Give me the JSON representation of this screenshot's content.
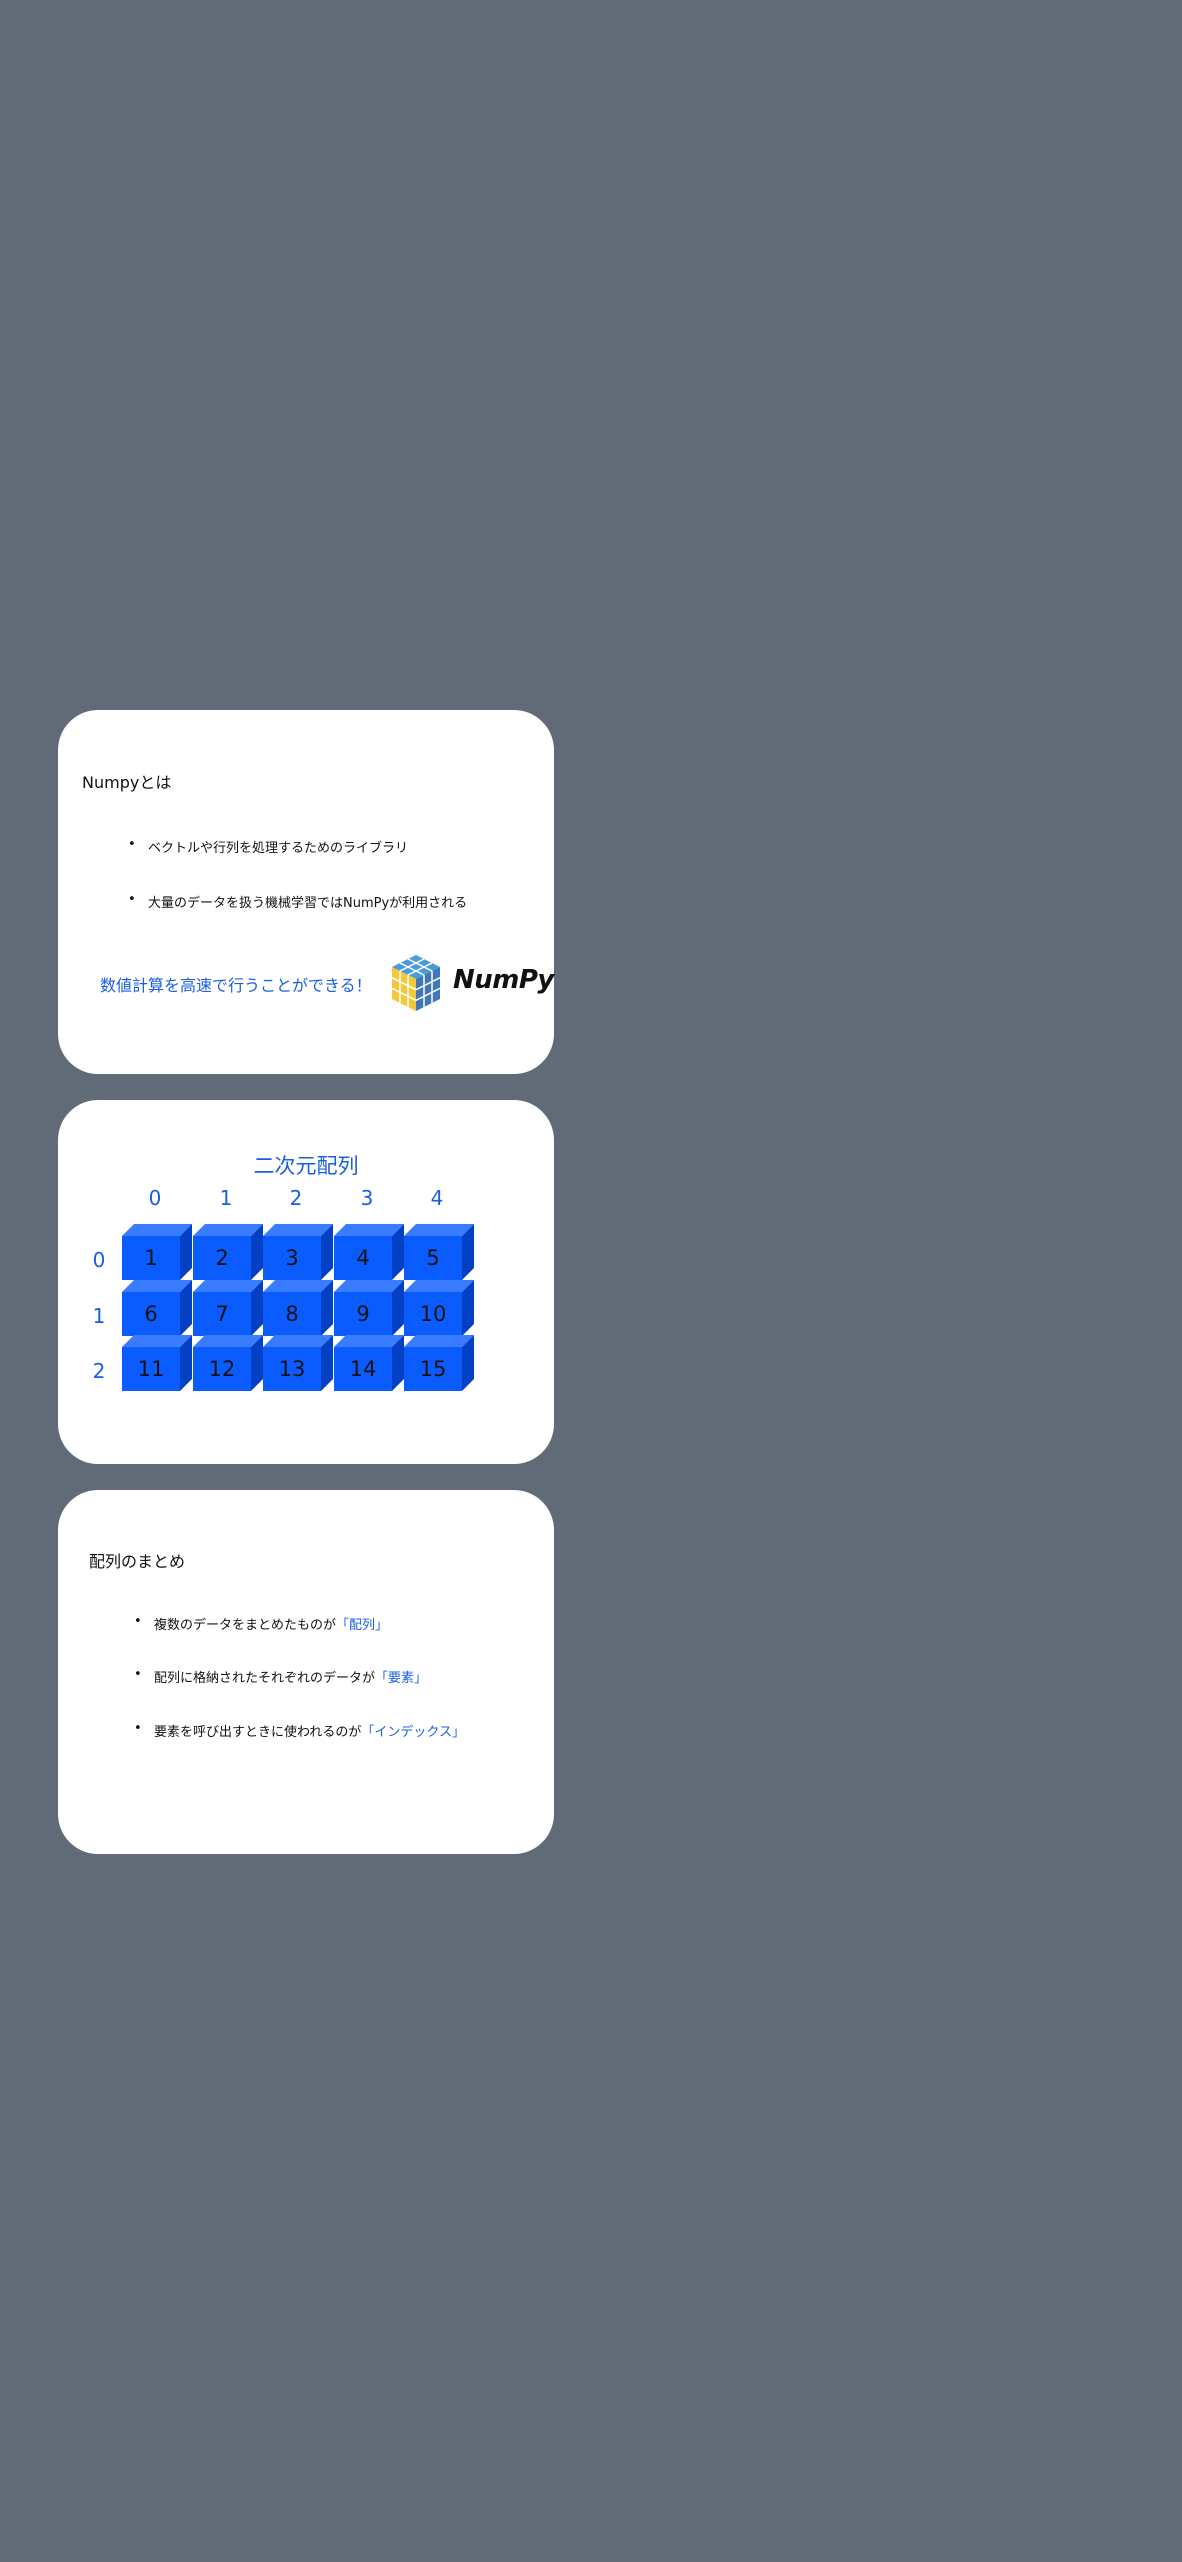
{
  "card1": {
    "title": "Numpyとは",
    "bullets": [
      "ベクトルや行列を処理するためのライブラリ",
      "大量のデータを扱う機械学習ではNumPyが利用される"
    ],
    "tagline": "数値計算を高速で行うことができる！",
    "logo_text": "NumPy",
    "logo_icon": "numpy-cube-logo"
  },
  "card2": {
    "title": "二次元配列",
    "col_indices": [
      "0",
      "1",
      "2",
      "3",
      "4"
    ],
    "row_indices": [
      "0",
      "1",
      "2"
    ],
    "cells": [
      [
        "1",
        "2",
        "3",
        "4",
        "5"
      ],
      [
        "6",
        "7",
        "8",
        "9",
        "10"
      ],
      [
        "11",
        "12",
        "13",
        "14",
        "15"
      ]
    ]
  },
  "card3": {
    "title": "配列のまとめ",
    "bullets": [
      {
        "text": "複数のデータをまとめたものが",
        "highlight": "「配列」"
      },
      {
        "text": "配列に格納されたそれぞれのデータが",
        "highlight": "「要素」"
      },
      {
        "text": "要素を呼び出すときに使われるのが",
        "highlight": "「インデックス」"
      }
    ]
  },
  "colors": {
    "background": "#616b78",
    "card": "#ffffff",
    "accent": "#1a5fe0",
    "cube_front": "#0a5cff"
  }
}
